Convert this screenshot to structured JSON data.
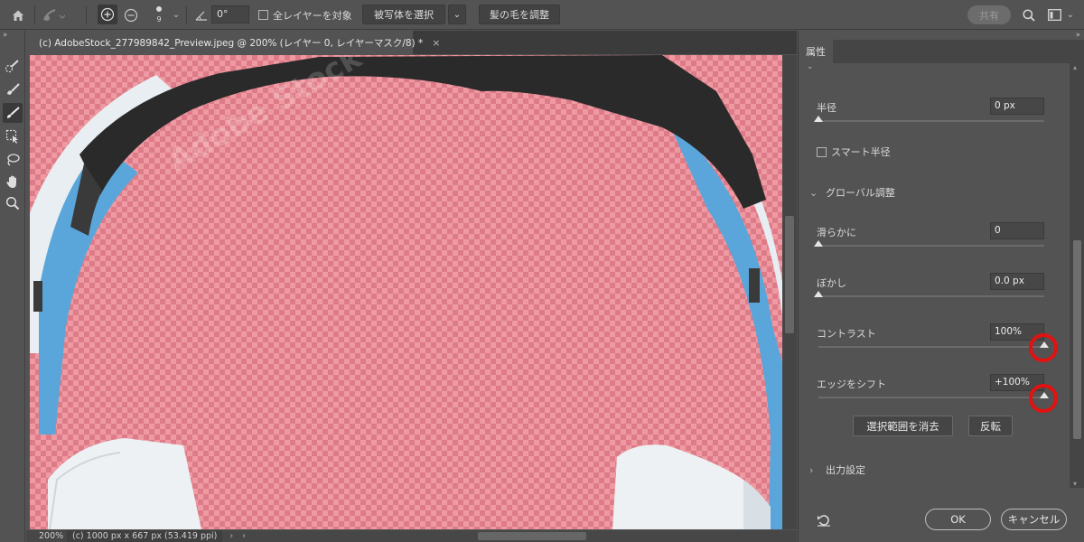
{
  "topbar": {
    "brush_size": "9",
    "angle_value": "0°",
    "sample_all_layers_label": "全レイヤーを対象",
    "select_subject_label": "被写体を選択",
    "refine_hair_label": "髪の毛を調整",
    "share_label": "共有"
  },
  "document": {
    "tab_title": "(c) AdobeStock_277989842_Preview.jpeg @ 200% (レイヤー 0, レイヤーマスク/8) *",
    "close_glyph": "×",
    "watermark": "Adobe Stock"
  },
  "status": {
    "zoom": "200%",
    "info": "(c) 1000 px x 667 px (53.419 ppi)"
  },
  "properties": {
    "tab_label": "属性",
    "radius_label": "半径",
    "radius_value": "0 px",
    "smart_radius_label": "スマート半径",
    "global_refinements_label": "グローバル調整",
    "smooth_label": "滑らかに",
    "smooth_value": "0",
    "feather_label": "ぼかし",
    "feather_value": "0.0 px",
    "contrast_label": "コントラスト",
    "contrast_value": "100%",
    "shift_edge_label": "エッジをシフト",
    "shift_edge_value": "+100%",
    "clear_selection_label": "選択範囲を消去",
    "invert_label": "反転",
    "output_settings_label": "出力設定",
    "ok_label": "OK",
    "cancel_label": "キャンセル"
  },
  "sliders": {
    "radius": 0,
    "smooth": 0,
    "feather": 0,
    "contrast": 1.0,
    "shift_edge": 1.0
  },
  "colors": {
    "overlay": "#ef9aa2",
    "highlight_ring": "#e01212",
    "headphone_band": "#2a2a2a",
    "headphone_blue": "#5aa6da"
  }
}
